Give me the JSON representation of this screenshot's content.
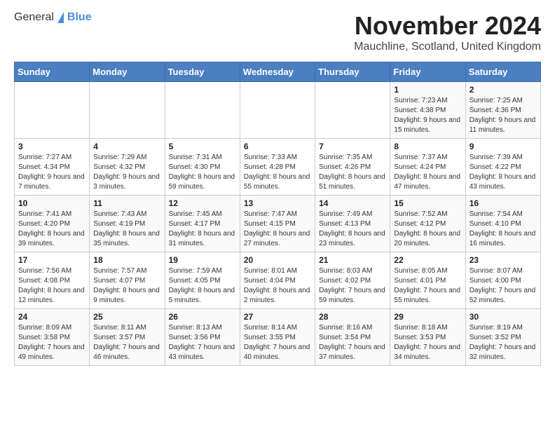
{
  "logo": {
    "general": "General",
    "blue": "Blue"
  },
  "title": "November 2024",
  "location": "Mauchline, Scotland, United Kingdom",
  "headers": [
    "Sunday",
    "Monday",
    "Tuesday",
    "Wednesday",
    "Thursday",
    "Friday",
    "Saturday"
  ],
  "weeks": [
    [
      {
        "day": "",
        "info": ""
      },
      {
        "day": "",
        "info": ""
      },
      {
        "day": "",
        "info": ""
      },
      {
        "day": "",
        "info": ""
      },
      {
        "day": "",
        "info": ""
      },
      {
        "day": "1",
        "info": "Sunrise: 7:23 AM\nSunset: 4:38 PM\nDaylight: 9 hours and 15 minutes."
      },
      {
        "day": "2",
        "info": "Sunrise: 7:25 AM\nSunset: 4:36 PM\nDaylight: 9 hours and 11 minutes."
      }
    ],
    [
      {
        "day": "3",
        "info": "Sunrise: 7:27 AM\nSunset: 4:34 PM\nDaylight: 9 hours and 7 minutes."
      },
      {
        "day": "4",
        "info": "Sunrise: 7:29 AM\nSunset: 4:32 PM\nDaylight: 9 hours and 3 minutes."
      },
      {
        "day": "5",
        "info": "Sunrise: 7:31 AM\nSunset: 4:30 PM\nDaylight: 8 hours and 59 minutes."
      },
      {
        "day": "6",
        "info": "Sunrise: 7:33 AM\nSunset: 4:28 PM\nDaylight: 8 hours and 55 minutes."
      },
      {
        "day": "7",
        "info": "Sunrise: 7:35 AM\nSunset: 4:26 PM\nDaylight: 8 hours and 51 minutes."
      },
      {
        "day": "8",
        "info": "Sunrise: 7:37 AM\nSunset: 4:24 PM\nDaylight: 8 hours and 47 minutes."
      },
      {
        "day": "9",
        "info": "Sunrise: 7:39 AM\nSunset: 4:22 PM\nDaylight: 8 hours and 43 minutes."
      }
    ],
    [
      {
        "day": "10",
        "info": "Sunrise: 7:41 AM\nSunset: 4:20 PM\nDaylight: 8 hours and 39 minutes."
      },
      {
        "day": "11",
        "info": "Sunrise: 7:43 AM\nSunset: 4:19 PM\nDaylight: 8 hours and 35 minutes."
      },
      {
        "day": "12",
        "info": "Sunrise: 7:45 AM\nSunset: 4:17 PM\nDaylight: 8 hours and 31 minutes."
      },
      {
        "day": "13",
        "info": "Sunrise: 7:47 AM\nSunset: 4:15 PM\nDaylight: 8 hours and 27 minutes."
      },
      {
        "day": "14",
        "info": "Sunrise: 7:49 AM\nSunset: 4:13 PM\nDaylight: 8 hours and 23 minutes."
      },
      {
        "day": "15",
        "info": "Sunrise: 7:52 AM\nSunset: 4:12 PM\nDaylight: 8 hours and 20 minutes."
      },
      {
        "day": "16",
        "info": "Sunrise: 7:54 AM\nSunset: 4:10 PM\nDaylight: 8 hours and 16 minutes."
      }
    ],
    [
      {
        "day": "17",
        "info": "Sunrise: 7:56 AM\nSunset: 4:08 PM\nDaylight: 8 hours and 12 minutes."
      },
      {
        "day": "18",
        "info": "Sunrise: 7:57 AM\nSunset: 4:07 PM\nDaylight: 8 hours and 9 minutes."
      },
      {
        "day": "19",
        "info": "Sunrise: 7:59 AM\nSunset: 4:05 PM\nDaylight: 8 hours and 5 minutes."
      },
      {
        "day": "20",
        "info": "Sunrise: 8:01 AM\nSunset: 4:04 PM\nDaylight: 8 hours and 2 minutes."
      },
      {
        "day": "21",
        "info": "Sunrise: 8:03 AM\nSunset: 4:02 PM\nDaylight: 7 hours and 59 minutes."
      },
      {
        "day": "22",
        "info": "Sunrise: 8:05 AM\nSunset: 4:01 PM\nDaylight: 7 hours and 55 minutes."
      },
      {
        "day": "23",
        "info": "Sunrise: 8:07 AM\nSunset: 4:00 PM\nDaylight: 7 hours and 52 minutes."
      }
    ],
    [
      {
        "day": "24",
        "info": "Sunrise: 8:09 AM\nSunset: 3:58 PM\nDaylight: 7 hours and 49 minutes."
      },
      {
        "day": "25",
        "info": "Sunrise: 8:11 AM\nSunset: 3:57 PM\nDaylight: 7 hours and 46 minutes."
      },
      {
        "day": "26",
        "info": "Sunrise: 8:13 AM\nSunset: 3:56 PM\nDaylight: 7 hours and 43 minutes."
      },
      {
        "day": "27",
        "info": "Sunrise: 8:14 AM\nSunset: 3:55 PM\nDaylight: 7 hours and 40 minutes."
      },
      {
        "day": "28",
        "info": "Sunrise: 8:16 AM\nSunset: 3:54 PM\nDaylight: 7 hours and 37 minutes."
      },
      {
        "day": "29",
        "info": "Sunrise: 8:18 AM\nSunset: 3:53 PM\nDaylight: 7 hours and 34 minutes."
      },
      {
        "day": "30",
        "info": "Sunrise: 8:19 AM\nSunset: 3:52 PM\nDaylight: 7 hours and 32 minutes."
      }
    ]
  ]
}
